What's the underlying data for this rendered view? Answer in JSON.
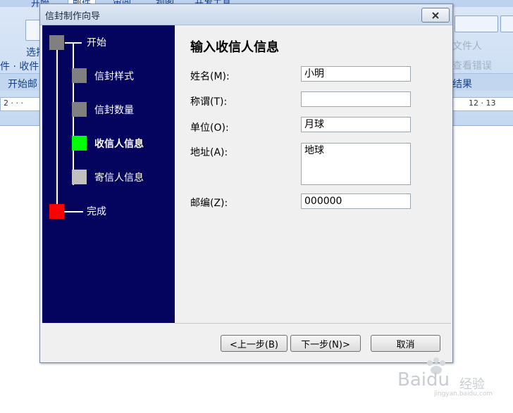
{
  "background": {
    "ribbon_tabs": [
      "开始",
      "邮件",
      "审阅",
      "视图",
      "开发工具"
    ],
    "left_group_button": "选择",
    "left_group_row": "件 · 收件",
    "left_group_name": "开始邮",
    "right_button": "文件人",
    "right_row": "查看错误",
    "right_group_name": "结果",
    "ruler_left": "2 · · ·",
    "ruler_right": "12 · 13"
  },
  "dialog": {
    "title": "信封制作向导",
    "close_icon": "close-icon",
    "steps": [
      {
        "label": "开始",
        "color": "#808080"
      },
      {
        "label": "信封样式",
        "color": "#808080"
      },
      {
        "label": "信封数量",
        "color": "#808080"
      },
      {
        "label": "收信人信息",
        "color": "#00ff00"
      },
      {
        "label": "寄信人信息",
        "color": "#c0c0c0"
      },
      {
        "label": "完成",
        "color": "#ff0000"
      }
    ],
    "content_title": "输入收信人信息",
    "fields": {
      "name": {
        "label": "姓名(M):",
        "value": "小明"
      },
      "title": {
        "label": "称谓(T):",
        "value": ""
      },
      "company": {
        "label": "单位(O):",
        "value": "月球"
      },
      "address": {
        "label": "地址(A):",
        "value": "地球"
      },
      "zip": {
        "label": "邮编(Z):",
        "value": "000000"
      }
    },
    "buttons": {
      "back": "<上一步(B)",
      "next": "下一步(N)>",
      "cancel": "取消"
    }
  },
  "watermark": {
    "brand": "Baidu",
    "sub": "经验",
    "url": "jingyan.baidu.com"
  }
}
